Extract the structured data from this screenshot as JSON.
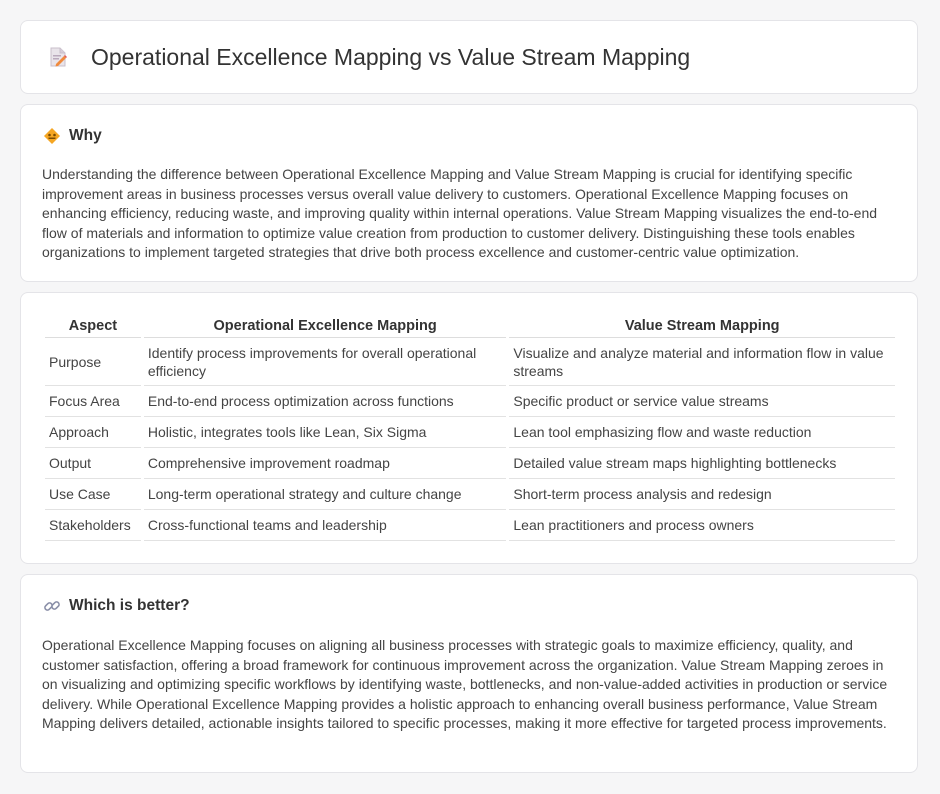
{
  "header": {
    "title": "Operational Excellence Mapping vs Value Stream Mapping",
    "icon": "document-pencil-icon"
  },
  "why": {
    "icon": "diamond-sign-icon",
    "title": "Why",
    "text": "Understanding the difference between Operational Excellence Mapping and Value Stream Mapping is crucial for identifying specific improvement areas in business processes versus overall value delivery to customers. Operational Excellence Mapping focuses on enhancing efficiency, reducing waste, and improving quality within internal operations. Value Stream Mapping visualizes the end-to-end flow of materials and information to optimize value creation from production to customer delivery. Distinguishing these tools enables organizations to implement targeted strategies that drive both process excellence and customer-centric value optimization."
  },
  "table": {
    "headers": [
      "Aspect",
      "Operational Excellence Mapping",
      "Value Stream Mapping"
    ],
    "rows": [
      [
        "Purpose",
        "Identify process improvements for overall operational efficiency",
        "Visualize and analyze material and information flow in value streams"
      ],
      [
        "Focus Area",
        "End-to-end process optimization across functions",
        "Specific product or service value streams"
      ],
      [
        "Approach",
        "Holistic, integrates tools like Lean, Six Sigma",
        "Lean tool emphasizing flow and waste reduction"
      ],
      [
        "Output",
        "Comprehensive improvement roadmap",
        "Detailed value stream maps highlighting bottlenecks"
      ],
      [
        "Use Case",
        "Long-term operational strategy and culture change",
        "Short-term process analysis and redesign"
      ],
      [
        "Stakeholders",
        "Cross-functional teams and leadership",
        "Lean practitioners and process owners"
      ]
    ]
  },
  "better": {
    "icon": "link-icon",
    "title": "Which is better?",
    "text": "Operational Excellence Mapping focuses on aligning all business processes with strategic goals to maximize efficiency, quality, and customer satisfaction, offering a broad framework for continuous improvement across the organization. Value Stream Mapping zeroes in on visualizing and optimizing specific workflows by identifying waste, bottlenecks, and non-value-added activities in production or service delivery. While Operational Excellence Mapping provides a holistic approach to enhancing overall business performance, Value Stream Mapping delivers detailed, actionable insights tailored to specific processes, making it more effective for targeted process improvements."
  },
  "colors": {
    "background": "#f6f6f7",
    "card": "#ffffff",
    "accent": "#f5a623"
  }
}
